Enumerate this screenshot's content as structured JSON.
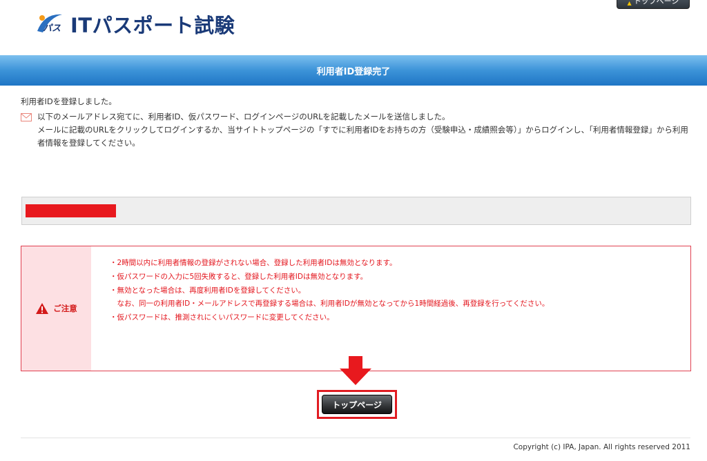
{
  "header": {
    "logo_mark_text": "パス",
    "logo_text": "ITパスポート試験",
    "top_button_label": "トップページ"
  },
  "page_title": "利用者ID登録完了",
  "message": "利用者IDを登録しました。",
  "mail_notice": {
    "line1": "以下のメールアドレス宛てに、利用者ID、仮パスワード、ログインページのURLを記載したメールを送信しました。",
    "line2": "メールに記載のURLをクリックしてログインするか、当サイトトップページの「すでに利用者IDをお持ちの方（受験申込・成績照会等）」からログインし、「利用者情報登録」から利用者情報を登録してください。"
  },
  "notice": {
    "label": "ご注意",
    "items": [
      "・2時間以内に利用者情報の登録がされない場合、登録した利用者IDは無効となります。",
      "・仮パスワードの入力に5回失敗すると、登録した利用者IDは無効となります。",
      "・無効となった場合は、再度利用者IDを登録してください。",
      "　なお、同一の利用者ID・メールアドレスで再登録する場合は、利用者IDが無効となってから1時間経過後、再登録を行ってください。",
      "・仮パスワードは、推測されにくいパスワードに変更してください。"
    ]
  },
  "cta": {
    "label": "トップページ"
  },
  "footer": {
    "copyright": "Copyright (c) IPA, Japan. All rights reserved 2011"
  },
  "colors": {
    "accent_red": "#e3141c",
    "band_blue": "#3c93d8",
    "logo_navy": "#1a3a78"
  }
}
